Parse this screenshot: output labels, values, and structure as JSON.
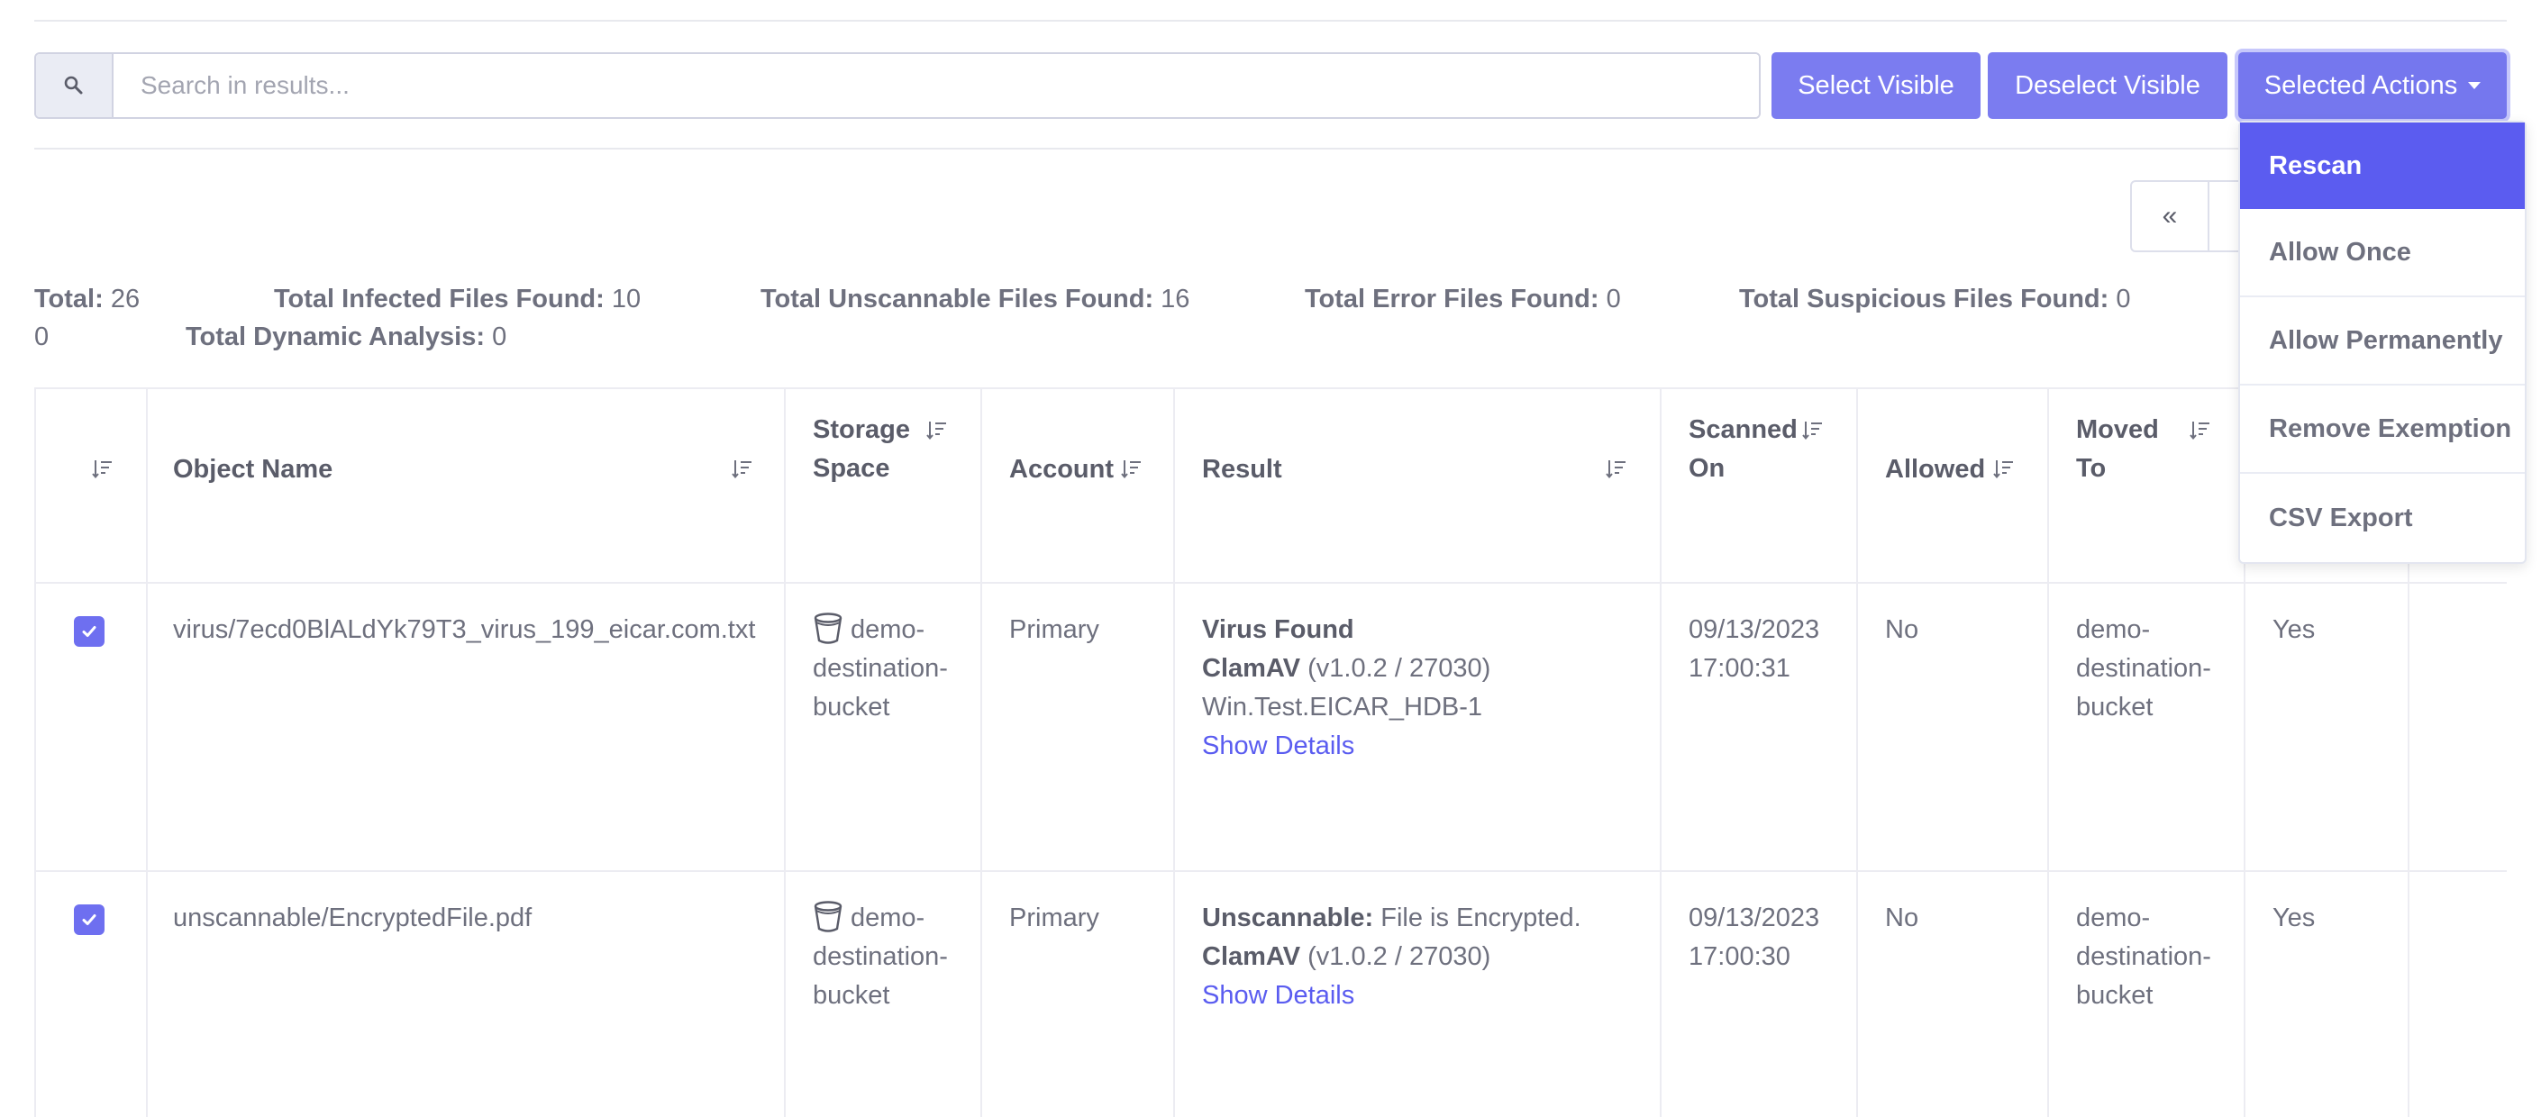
{
  "search": {
    "placeholder": "Search in results..."
  },
  "toolbar": {
    "select_visible": "Select Visible",
    "deselect_visible": "Deselect Visible",
    "selected_actions": "Selected Actions"
  },
  "pager": {
    "first": "«"
  },
  "totals": {
    "total_label": "Total:",
    "total_value_line1": "26",
    "total_value_line2": "0",
    "infected_label": "Total Infected Files Found:",
    "infected_value": "10",
    "unscannable_label": "Total Unscannable Files Found:",
    "unscannable_value": "16",
    "error_label": "Total Error Files Found:",
    "error_value": "0",
    "suspicious_label": "Total Suspicious Files Found:",
    "suspicious_value": "0",
    "dynamic_label": "Total Dynamic Analysis:",
    "dynamic_value": "0"
  },
  "table": {
    "columns": {
      "object_name": "Object Name",
      "storage_space_1": "Storage",
      "storage_space_2": "Space",
      "account": "Account",
      "result": "Result",
      "scanned_on_1": "Scanned",
      "scanned_on_2": "On",
      "allowed": "Allowed",
      "moved_to_1": "Moved",
      "moved_to_2": "To"
    },
    "rows": [
      {
        "checked": true,
        "object_name": "virus/7ecd0BlALdYk79T3_virus_199_eicar.com.txt",
        "storage": [
          "demo-",
          "destination-",
          "bucket"
        ],
        "account": "Primary",
        "result_title": "Virus Found",
        "engine": "ClamAV",
        "engine_version": "(v1.0.2 / 27030)",
        "signature": "Win.Test.EICAR_HDB-1",
        "details_link": "Show Details",
        "scanned_date": "09/13/2023",
        "scanned_time": "17:00:31",
        "allowed": "No",
        "moved_to": [
          "demo-",
          "destination-",
          "bucket"
        ],
        "extra": "Yes"
      },
      {
        "checked": true,
        "object_name": "unscannable/EncryptedFile.pdf",
        "storage": [
          "demo-",
          "destination-",
          "bucket"
        ],
        "account": "Primary",
        "result_title": "Unscannable:",
        "result_detail": "File is Encrypted.",
        "engine": "ClamAV",
        "engine_version": "(v1.0.2 / 27030)",
        "details_link": "Show Details",
        "scanned_date": "09/13/2023",
        "scanned_time": "17:00:30",
        "allowed": "No",
        "moved_to": [
          "demo-",
          "destination-",
          "bucket"
        ],
        "extra": "Yes"
      }
    ]
  },
  "dropdown": {
    "items": [
      "Rescan",
      "Allow Once",
      "Allow Permanently",
      "Remove Exemption",
      "CSV Export"
    ],
    "active_index": 0
  },
  "colors": {
    "accent": "#7b7cf0",
    "active": "#5b5cf0",
    "link": "#5a5cf0"
  }
}
